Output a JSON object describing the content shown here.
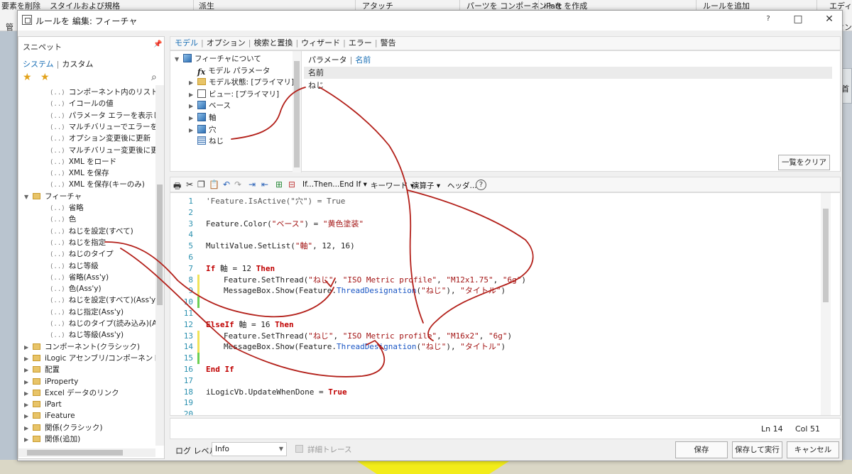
{
  "ribbon": {
    "items": [
      "要素を削除",
      "スタイルおよび規格",
      "派生",
      "アタッチ",
      "パーツを コンポーネントを",
      "iPart を作成",
      "ルールを追加",
      "エディタ"
    ],
    "fragments": [
      "管",
      "ト",
      "セン",
      "首"
    ]
  },
  "window": {
    "title": "ルールを 編集: フィーチャ",
    "help_icon": "?",
    "maximize_icon": "□",
    "close_icon": "✕"
  },
  "snippets": {
    "title": "スニペット",
    "pin_icon": "pin-icon",
    "tabs": [
      "システム",
      "カスタム"
    ],
    "items": [
      {
        "type": "item",
        "label": "コンポーネント内のリストを取得"
      },
      {
        "type": "item",
        "label": "イコールの値"
      },
      {
        "type": "item",
        "label": "パラメータ エラーを表示しない"
      },
      {
        "type": "item",
        "label": "マルチバリューでエラーを表示した"
      },
      {
        "type": "item",
        "label": "オプション変更後に更新"
      },
      {
        "type": "item",
        "label": "マルチバリュー変更後に更新"
      },
      {
        "type": "item",
        "label": "XML をロード"
      },
      {
        "type": "item",
        "label": "XML を保存"
      },
      {
        "type": "item",
        "label": "XML を保存(キーのみ)"
      },
      {
        "type": "folder-open",
        "label": "フィーチャ"
      },
      {
        "type": "item",
        "label": "省略"
      },
      {
        "type": "item",
        "label": "色"
      },
      {
        "type": "item",
        "label": "ねじを設定(すべて)"
      },
      {
        "type": "item",
        "label": "ねじを指定"
      },
      {
        "type": "item",
        "label": "ねじのタイプ"
      },
      {
        "type": "item",
        "label": "ねじ等級"
      },
      {
        "type": "item",
        "label": "省略(Ass'y)"
      },
      {
        "type": "item",
        "label": "色(Ass'y)"
      },
      {
        "type": "item",
        "label": "ねじを設定(すべて)(Ass'y)"
      },
      {
        "type": "item",
        "label": "ねじ指定(Ass'y)"
      },
      {
        "type": "item",
        "label": "ねじのタイプ(読み込み)(Ass'y)"
      },
      {
        "type": "item",
        "label": "ねじ等級(Ass'y)"
      },
      {
        "type": "folder",
        "label": "コンポーネント(クラシック)"
      },
      {
        "type": "folder",
        "label": "iLogic アセンブリ/コンポーネント"
      },
      {
        "type": "folder",
        "label": "配置"
      },
      {
        "type": "folder",
        "label": "iProperty"
      },
      {
        "type": "folder",
        "label": "Excel データのリンク"
      },
      {
        "type": "folder",
        "label": "iPart"
      },
      {
        "type": "folder",
        "label": "iFeature"
      },
      {
        "type": "folder",
        "label": "関係(クラシック)"
      },
      {
        "type": "folder",
        "label": "関係(追加)"
      }
    ]
  },
  "tabs": [
    "モデル",
    "オプション",
    "検索と置換",
    "ウィザード",
    "エラー",
    "警告"
  ],
  "model_tree": [
    {
      "label": "フィーチャについて",
      "icon": "cube",
      "arrow": "▼",
      "indent": 0
    },
    {
      "label": "モデル パラメータ",
      "icon": "fx",
      "arrow": "",
      "indent": 1
    },
    {
      "label": "モデル状態: [プライマリ]",
      "icon": "folder",
      "arrow": "▶",
      "indent": 1
    },
    {
      "label": "ビュー: [プライマリ]",
      "icon": "view",
      "arrow": "▶",
      "indent": 1
    },
    {
      "label": "ベース",
      "icon": "cube",
      "arrow": "▶",
      "indent": 1
    },
    {
      "label": "軸",
      "icon": "cube",
      "arrow": "▶",
      "indent": 1
    },
    {
      "label": "穴",
      "icon": "cube",
      "arrow": "▶",
      "indent": 1
    },
    {
      "label": "ねじ",
      "icon": "thread",
      "arrow": "",
      "indent": 1
    }
  ],
  "params": {
    "tabs": [
      "パラメータ",
      "名前"
    ],
    "column_header": "名前",
    "row": "ねじ",
    "clear_button": "一覧をクリア"
  },
  "toolbar": {
    "ifthen": "If...Then...End If ▾",
    "keyword": "キーワード ▾",
    "operator": "演算子 ▾",
    "header": "ヘッダ...",
    "help_icon": "?"
  },
  "code_lines": [
    "'Feature.IsActive(\"穴\") = True",
    "",
    "Feature.Color(\"ベース\") = \"黄色塗装\"",
    "",
    "MultiValue.SetList(\"軸\", 12, 16)",
    "",
    "If 軸 = 12 Then",
    "Feature.SetThread(\"ねじ\", \"ISO Metric profile\", \"M12x1.75\", \"6g\")",
    "MessageBox.Show(Feature.ThreadDesignation(\"ねじ\"), \"タイトル\")",
    "",
    "",
    "ElseIf 軸 = 16 Then",
    "Feature.SetThread(\"ねじ\", \"ISO Metric profile\", \"M16x2\", \"6g\")",
    "MessageBox.Show(Feature.ThreadDesignation(\"ねじ\"), \"タイトル\")",
    "",
    "End If",
    "",
    "iLogicVb.UpdateWhenDone = True",
    "",
    ""
  ],
  "status": {
    "ln": "Ln 14",
    "col": "Col 51"
  },
  "bottom": {
    "log_label": "ログ レベル",
    "log_value": "Info",
    "trace_label": "詳細トレース",
    "save": "保存",
    "save_run": "保存して実行",
    "cancel": "キャンセル"
  },
  "colors": {
    "accent": "#1a6fb5",
    "keyword": "#c00000",
    "string": "#a31515",
    "annotation": "#b3201a"
  }
}
